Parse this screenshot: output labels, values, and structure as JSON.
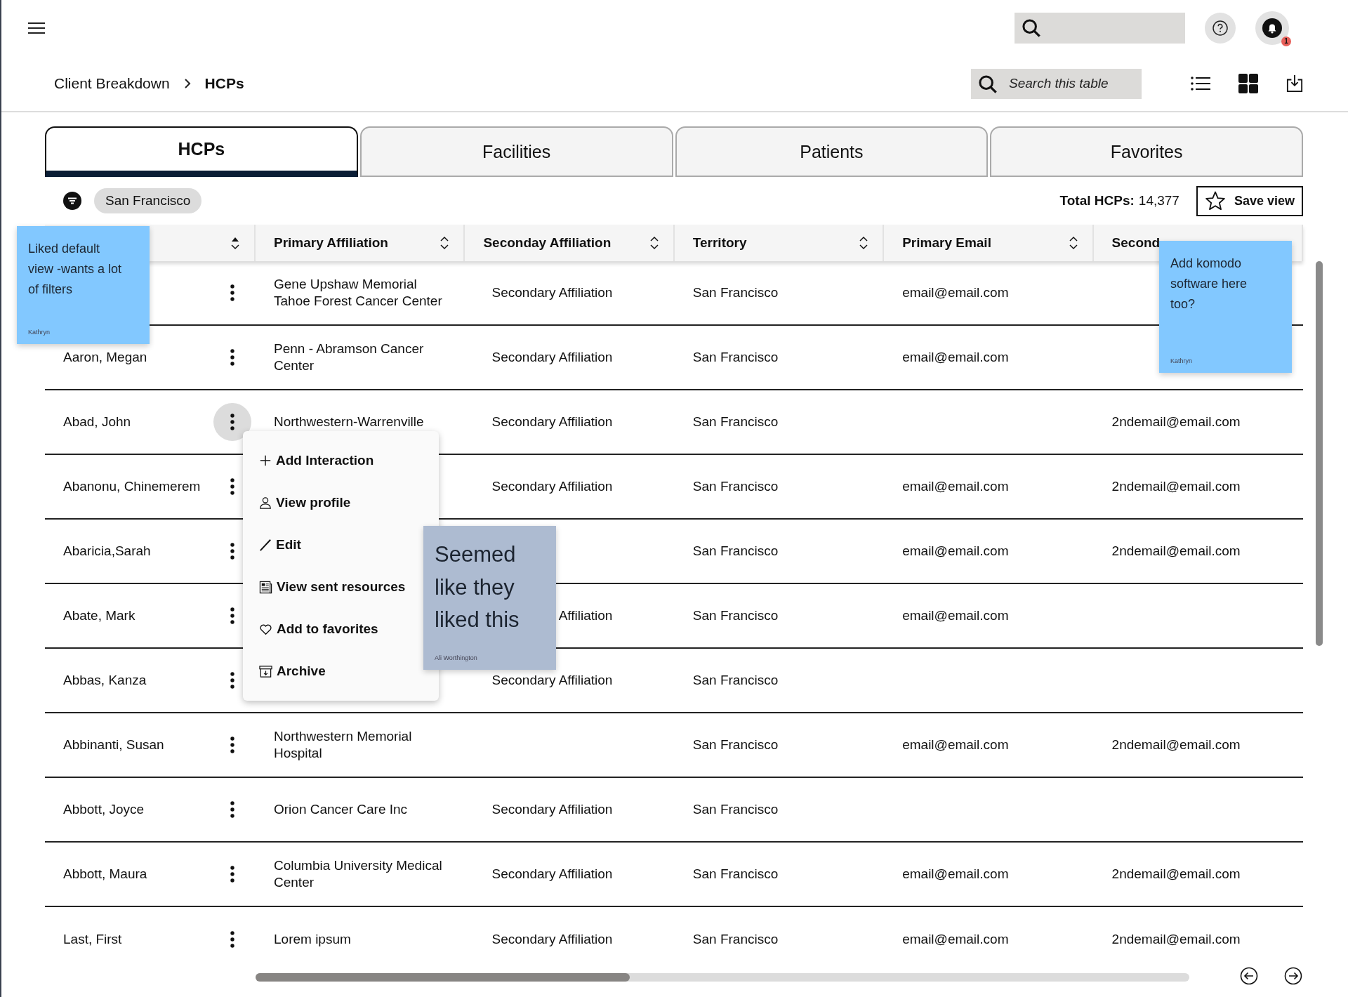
{
  "header": {
    "notification_count": "1"
  },
  "breadcrumb": {
    "parent": "Client Breakdown",
    "current": "HCPs"
  },
  "table_search": {
    "placeholder": "Search this table"
  },
  "tabs": [
    {
      "label": "HCPs",
      "selected": true
    },
    {
      "label": "Facilities",
      "selected": false
    },
    {
      "label": "Patients",
      "selected": false
    },
    {
      "label": "Favorites",
      "selected": false
    }
  ],
  "filter_chip": "San Francisco",
  "total": {
    "label": "Total HCPs:",
    "value": "14,377"
  },
  "save_view": "Save view",
  "columns": [
    {
      "sorted": true
    },
    {
      "label": "Primary Affiliation",
      "sorted": false
    },
    {
      "label": "Seconday Affiliation",
      "sorted": false
    },
    {
      "label": "Territory",
      "sorted": false
    },
    {
      "label": "Primary Email",
      "sorted": false
    },
    {
      "label": "Second"
    }
  ],
  "rows": [
    {
      "primary": "Gene Upshaw Memorial Tahoe Forest Cancer Center",
      "secondary": "Secondary Affiliation",
      "territory": "San Francisco",
      "email": "email@email.com",
      "menu_open": false
    },
    {
      "name": "Aaron, Megan",
      "primary": "Penn - Abramson Cancer Center",
      "secondary": "Secondary Affiliation",
      "territory": "San Francisco",
      "email": "email@email.com",
      "menu_open": false
    },
    {
      "name": "Abad, John",
      "primary": "Northwestern-Warrenville",
      "secondary": "Secondary Affiliation",
      "territory": "San Francisco",
      "email2": "2ndemail@email.com",
      "menu_open": true
    },
    {
      "name": "Abanonu, Chinemerem",
      "secondary": "Secondary Affiliation",
      "territory": "San Francisco",
      "email": "email@email.com",
      "email2": "2ndemail@email.com",
      "menu_open": false
    },
    {
      "name": "Abaricia,Sarah",
      "territory": "San Francisco",
      "email": "email@email.com",
      "email2": "2ndemail@email.com",
      "menu_open": false
    },
    {
      "name": "Abate, Mark",
      "secondary": "Affiliation",
      "territory": "San Francisco",
      "email": "email@email.com",
      "menu_open": false
    },
    {
      "name": "Abbas, Kanza",
      "secondary": "Secondary Affiliation",
      "territory": "San Francisco",
      "menu_open": false
    },
    {
      "name": "Abbinanti, Susan",
      "primary": "Northwestern Memorial Hospital",
      "territory": "San Francisco",
      "email": "email@email.com",
      "email2": "2ndemail@email.com",
      "menu_open": false
    },
    {
      "name": "Abbott, Joyce",
      "primary": "Orion Cancer Care Inc",
      "secondary": "Secondary Affiliation",
      "territory": "San Francisco",
      "menu_open": false
    },
    {
      "name": "Abbott, Maura",
      "primary": "Columbia University Medical Center",
      "secondary": "Secondary Affiliation",
      "territory": "San Francisco",
      "email": "email@email.com",
      "email2": "2ndemail@email.com",
      "menu_open": false
    },
    {
      "name": "Last, First",
      "primary": "Lorem ipsum",
      "secondary": "Secondary Affiliation",
      "territory": "San Francisco",
      "email": "email@email.com",
      "email2": "2ndemail@email.com",
      "menu_open": false
    }
  ],
  "row_menu": [
    "Add Interaction",
    "View profile",
    "Edit",
    "View sent resources",
    "Add to favorites",
    "Archive"
  ],
  "notes": [
    {
      "text": "Liked default view -wants a lot of filters",
      "author": "Kathryn",
      "color": "#82c8ff",
      "kind": "small"
    },
    {
      "text": "Add komodo software here too?",
      "author": "Kathryn",
      "color": "#82c8ff",
      "kind": "small"
    },
    {
      "text": "Seemed like they liked this",
      "author": "Ali Worthington",
      "color": "#adbbd1",
      "kind": "large"
    }
  ]
}
